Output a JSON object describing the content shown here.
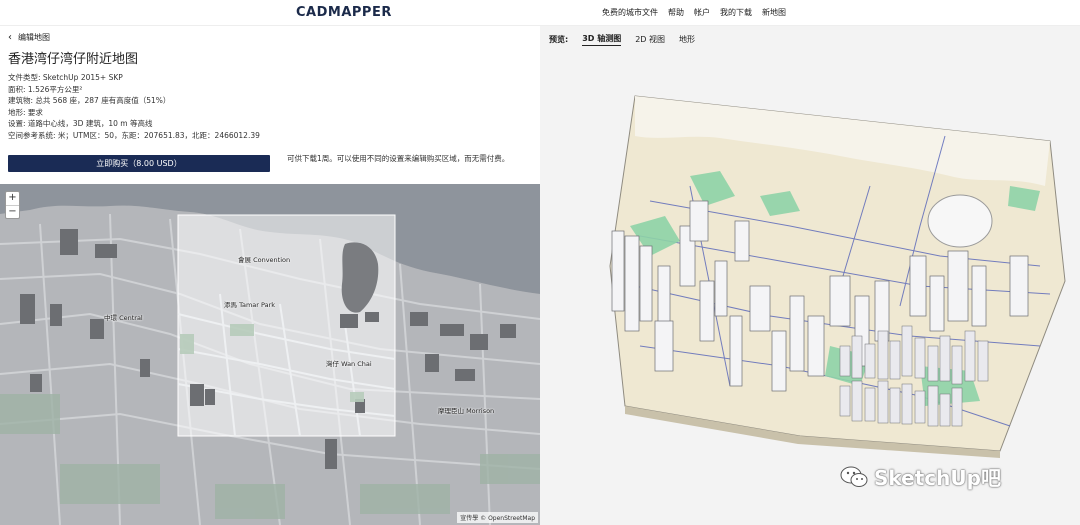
{
  "header": {
    "logo": "CADMAPPER",
    "nav": [
      "免费的城市文件",
      "帮助",
      "帐户",
      "我的下载",
      "新地图"
    ]
  },
  "left": {
    "back_label": "编辑地图",
    "title": "香港湾仔湾仔附近地图",
    "meta": [
      "文件类型:  SketchUp 2015+ SKP",
      "面积:  1.526平方公里²",
      "建筑物:  总共 568 座，287 座有高度值（51%）",
      "地形:  要求",
      "设置:  道路中心线，3D 建筑，10 m 等高线",
      "空间参考系统:  米；UTM区：50，东距：207651.83，北距：2466012.39"
    ],
    "buy_button": "立即购买（8.00 USD）",
    "note": "可供下载1周。可以使用不同的设置来编辑购买区域，而无需付费。"
  },
  "map": {
    "zoom_in": "+",
    "zoom_out": "−",
    "labels": {
      "central": "中環 Central",
      "wanchai": "灣仔 Wan Chai",
      "morrison": "摩理臣山 Morrison",
      "tamar": "添馬 Tamar Park",
      "expo": "會展 Convention"
    },
    "attribution": "宣传學 © OpenStreetMap"
  },
  "right": {
    "preview_label": "预览:",
    "tabs": [
      "3D 轴测图",
      "2D 视图",
      "地形"
    ],
    "active_tab": "3D 轴测图"
  },
  "watermark": {
    "text": "SketchUp吧"
  },
  "colors": {
    "accent": "#1a2b55",
    "selection": "#ffffff"
  }
}
